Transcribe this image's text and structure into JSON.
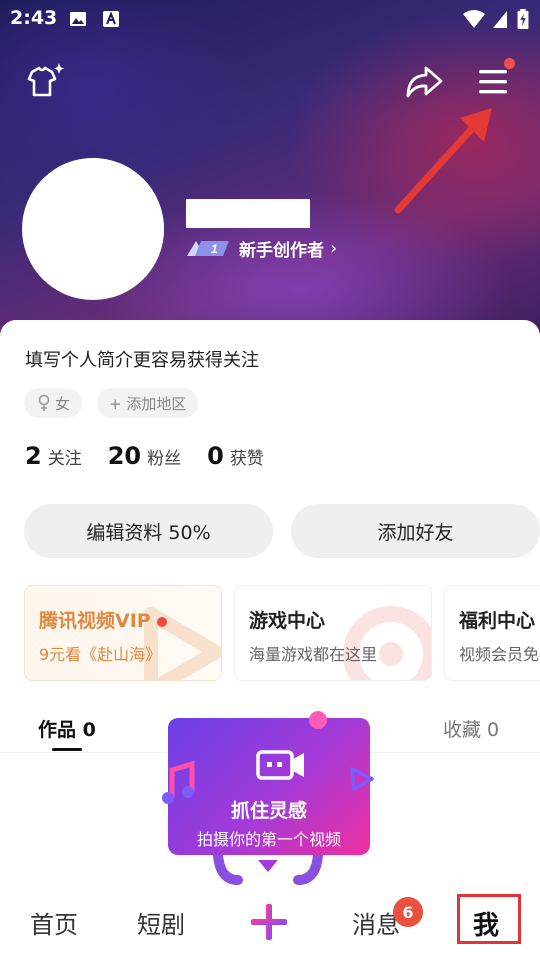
{
  "status_bar": {
    "time": "2:43"
  },
  "header": {
    "icons": [
      "tshirt-sparkle-icon",
      "share-icon",
      "menu-icon"
    ]
  },
  "profile": {
    "creator_level": "1",
    "creator_label": "新手创作者",
    "chevron": "›"
  },
  "bio": {
    "prompt": "填写个人简介更容易获得关注",
    "gender_tag": "女",
    "region_tag": "+ 添加地区"
  },
  "stats": [
    {
      "num": "2",
      "label": "关注"
    },
    {
      "num": "20",
      "label": "粉丝"
    },
    {
      "num": "0",
      "label": "获赞"
    }
  ],
  "actions": {
    "edit_profile": "编辑资料 50%",
    "add_friend": "添加好友"
  },
  "services": [
    {
      "title": "腾讯视频VIP",
      "subtitle": "9元看《赴山海》"
    },
    {
      "title": "游戏中心",
      "subtitle": "海量游戏都在这里"
    },
    {
      "title": "福利中心",
      "subtitle": "视频会员免"
    }
  ],
  "tabs": [
    {
      "label": "作品 0"
    },
    {
      "label": "收藏 0"
    }
  ],
  "popup": {
    "title": "抓住灵感",
    "subtitle": "拍摄你的第一个视频"
  },
  "bottom_nav": {
    "home": "首页",
    "drama": "短剧",
    "messages": "消息",
    "messages_badge": "6",
    "me": "我"
  },
  "colors": {
    "accent_red": "#e0343a",
    "vip_orange": "#e0883d",
    "popup_gradient_start": "#6b3fe6",
    "popup_gradient_end": "#ef2f9e"
  }
}
